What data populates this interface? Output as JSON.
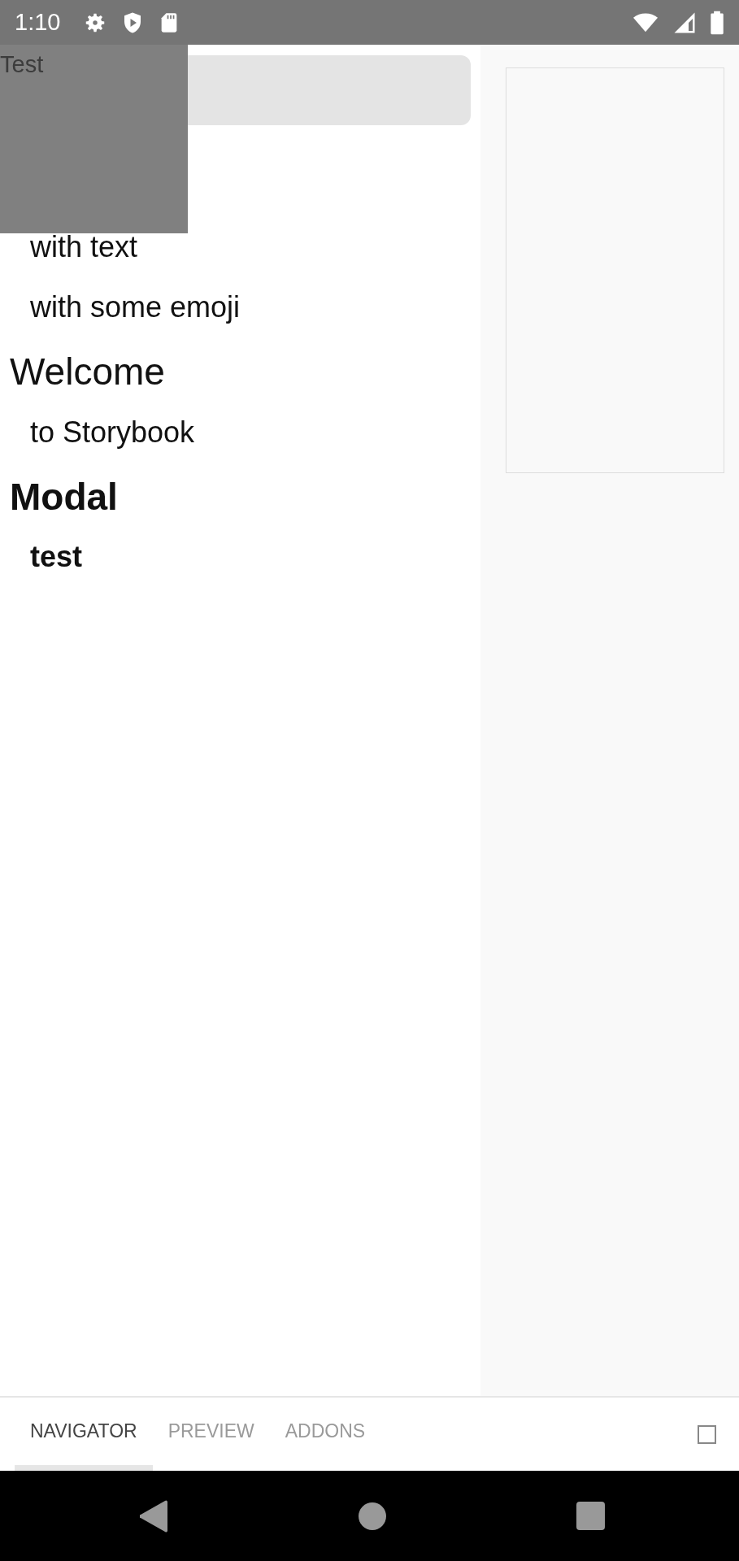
{
  "status_bar": {
    "time": "1:10"
  },
  "overlay": {
    "label": "Test"
  },
  "navigator": {
    "items": [
      {
        "kind": "story",
        "label": "with text"
      },
      {
        "kind": "story",
        "label": "with some emoji"
      },
      {
        "kind": "kind",
        "label": "Welcome"
      },
      {
        "kind": "story",
        "label": "to Storybook"
      },
      {
        "kind": "kind-bold",
        "label": "Modal"
      },
      {
        "kind": "story-bold",
        "label": "test"
      }
    ]
  },
  "tabs": [
    {
      "label": "NAVIGATOR",
      "selected": true
    },
    {
      "label": "PREVIEW",
      "selected": false
    },
    {
      "label": "ADDONS",
      "selected": false
    }
  ]
}
